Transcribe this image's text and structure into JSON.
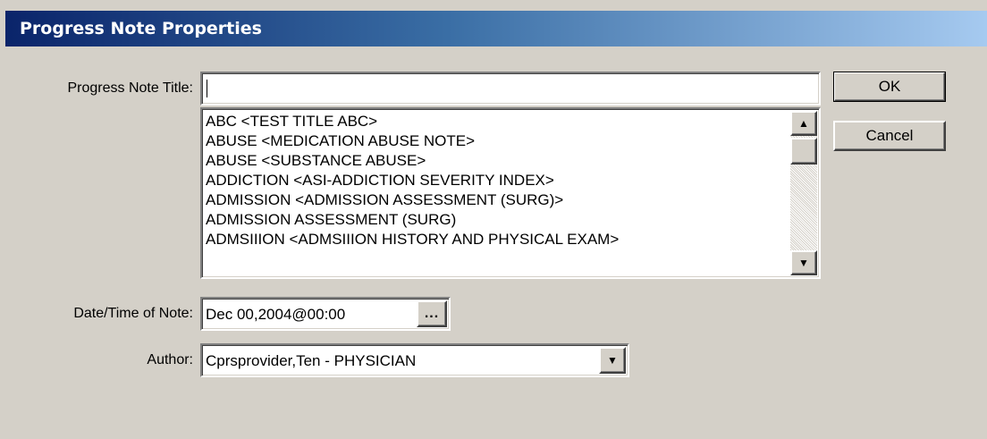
{
  "window": {
    "title": "Progress Note Properties"
  },
  "form": {
    "title_label": "Progress Note Title:",
    "title_value": "",
    "date_label": "Date/Time of Note:",
    "date_value": "Dec 00,2004@00:00",
    "date_button": "...",
    "author_label": "Author:",
    "author_value": "Cprsprovider,Ten - PHYSICIAN"
  },
  "list": {
    "items": [
      "ABC  <TEST TITLE ABC>",
      "ABUSE  <MEDICATION ABUSE NOTE>",
      "ABUSE  <SUBSTANCE ABUSE>",
      "ADDICTION  <ASI-ADDICTION SEVERITY INDEX>",
      "ADMISSION  <ADMISSION ASSESSMENT (SURG)>",
      "ADMISSION ASSESSMENT (SURG)",
      "ADMSIIION  <ADMSIIION HISTORY AND PHYSICAL EXAM>"
    ]
  },
  "buttons": {
    "ok": "OK",
    "cancel": "Cancel"
  },
  "icons": {
    "scroll_up": "triangle-up-icon",
    "scroll_down": "triangle-down-icon",
    "dropdown": "chevron-down-icon",
    "ellipsis": "ellipsis-icon"
  }
}
